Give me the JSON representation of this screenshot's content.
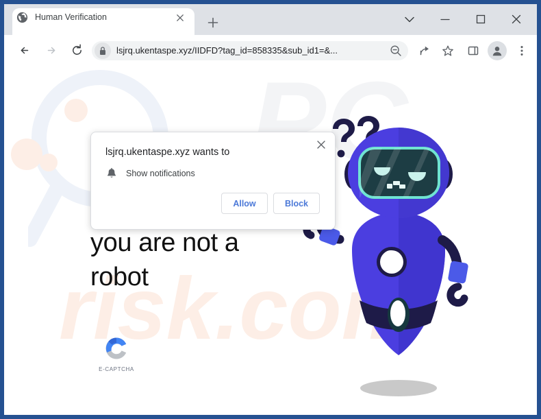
{
  "window": {
    "controls": [
      {
        "name": "tab-search-button",
        "icon": "chevron-down-icon"
      },
      {
        "name": "minimize-button",
        "icon": "minimize-icon"
      },
      {
        "name": "maximize-button",
        "icon": "maximize-icon"
      },
      {
        "name": "close-window-button",
        "icon": "close-icon"
      }
    ],
    "frame_color": "#255191",
    "chrome_color": "#dee1e6"
  },
  "tab_strip": {
    "active_tab": {
      "title": "Human Verification",
      "favicon": "globe-icon",
      "close_label": "Close tab"
    },
    "new_tab_label": "New Tab"
  },
  "toolbar": {
    "back_label": "Back",
    "forward_label": "Forward",
    "reload_label": "Reload",
    "url": "lsjrq.ukentaspe.xyz/IIDFD?tag_id=858335&sub_id1=&...",
    "lock_icon": "lock-icon",
    "zoom_icon": "zoom-out-icon",
    "share_icon": "share-icon",
    "bookmark_icon": "star-icon",
    "side_panel_icon": "side-panel-icon",
    "profile_icon": "person-icon",
    "menu_icon": "three-dots-icon"
  },
  "permission_dialog": {
    "title": "lsjrq.ukentaspe.xyz wants to",
    "request_icon": "bell-icon",
    "request_label": "Show notifications",
    "allow_label": "Allow",
    "block_label": "Block",
    "close_label": "Close",
    "button_text_color": "#4c79d8"
  },
  "page": {
    "headline": "Click Allow if you are not a robot",
    "captcha": {
      "label": "E-CAPTCHA",
      "mark_colors": [
        "#4285f4",
        "#3367d6",
        "#bdc1c6"
      ]
    },
    "illustration": {
      "name": "confused-robot",
      "question_marks": "??",
      "body_color": "#4b3ee0",
      "body_shade": "#3f33c9",
      "dark_color": "#1e1b48",
      "visor_fill": "#1d3d44",
      "visor_border": "#6fe3d2",
      "eye_color": "#c9f2ec",
      "shadow_color": "#c9c9c9"
    },
    "watermark_top": "PC",
    "watermark_bottom": "risk.com"
  }
}
